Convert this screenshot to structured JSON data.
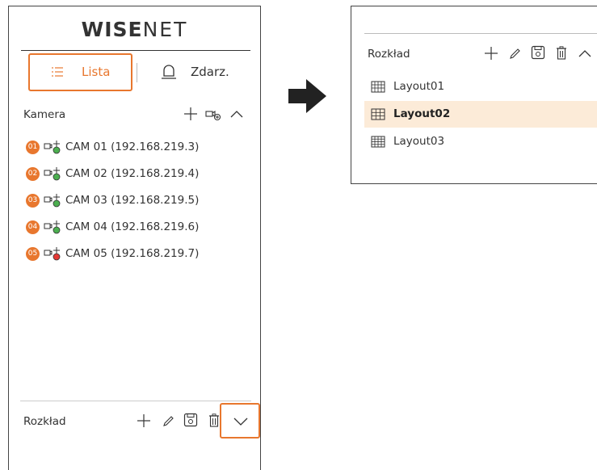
{
  "left_panel": {
    "logo": {
      "bold_part": "WISE",
      "thin_part": "NET"
    },
    "tabs": {
      "list_label": "Lista",
      "events_label": "Zdarz."
    },
    "camera_section": {
      "title": "Kamera",
      "cameras": [
        {
          "num": "01",
          "label": "CAM 01 (192.168.219.3)",
          "status_color": "#4caf50"
        },
        {
          "num": "02",
          "label": "CAM 02 (192.168.219.4)",
          "status_color": "#4caf50"
        },
        {
          "num": "03",
          "label": "CAM 03 (192.168.219.5)",
          "status_color": "#4caf50"
        },
        {
          "num": "04",
          "label": "CAM 04 (192.168.219.6)",
          "status_color": "#4caf50"
        },
        {
          "num": "05",
          "label": "CAM 05 (192.168.219.7)",
          "status_color": "#e53935"
        }
      ]
    },
    "schedule_section": {
      "title": "Rozkład"
    }
  },
  "right_panel": {
    "schedule_section": {
      "title": "Rozkład",
      "layouts": [
        {
          "label": "Layout01",
          "icon": "grid-64-icon",
          "selected": false
        },
        {
          "label": "Layout02",
          "icon": "grid-9-icon",
          "selected": true
        },
        {
          "label": "Layout03",
          "icon": "grid-16-icon",
          "selected": false
        }
      ]
    }
  },
  "colors": {
    "accent": "#e8772e",
    "selected_bg": "#fcebd8",
    "border": "#444444"
  }
}
